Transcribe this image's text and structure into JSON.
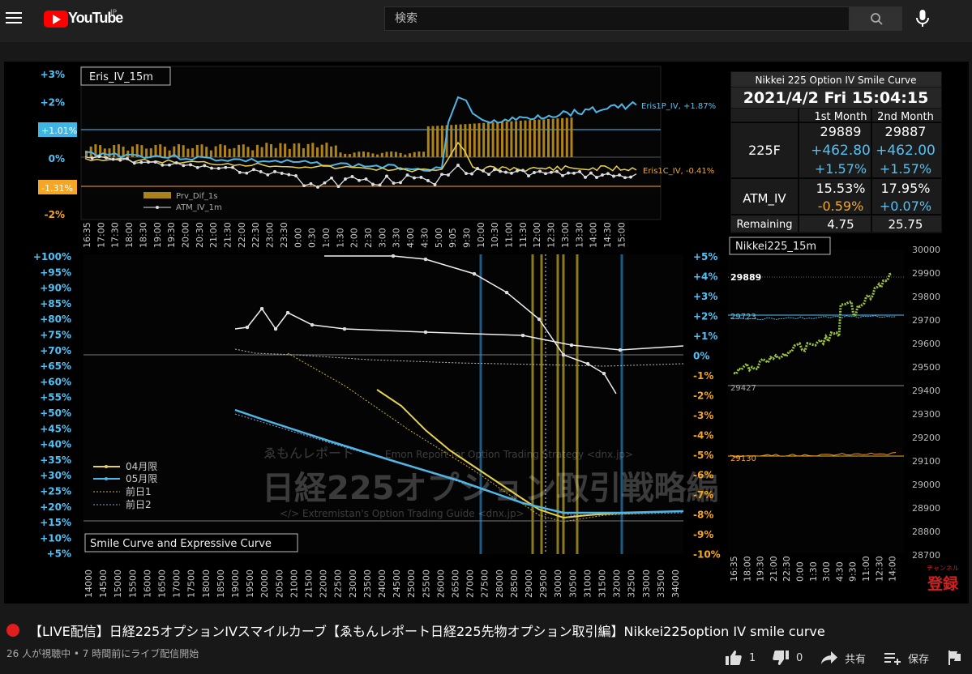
{
  "header": {
    "brand": "YouTube",
    "region": "JP",
    "search_placeholder": "検索"
  },
  "chart_top_left": {
    "label": "Eris_IV_15m",
    "y_ticks": [
      "+3%",
      "+2%",
      "+1%",
      "0%",
      "-1%",
      "-2%"
    ],
    "badge_blue": "+1.01%",
    "badge_orange": "-1.31%",
    "series_label_1": "Eris1P_IV, +1.87%",
    "series_label_2": "Eris1C_IV, -0.41%",
    "legend_1": "Prv_Dif_1s",
    "legend_2": "ATM_IV_1m",
    "x_ticks": [
      "16:35",
      "17:00",
      "17:30",
      "18:00",
      "18:30",
      "19:00",
      "19:30",
      "20:00",
      "20:30",
      "21:00",
      "21:30",
      "22:00",
      "22:30",
      "23:00",
      "23:30",
      "0:00",
      "0:30",
      "1:00",
      "1:30",
      "2:00",
      "2:30",
      "3:00",
      "3:30",
      "4:00",
      "4:30",
      "5:00",
      "9:05",
      "9:30",
      "10:00",
      "10:30",
      "11:00",
      "11:30",
      "12:00",
      "12:30",
      "13:00",
      "13:30",
      "14:00",
      "14:30",
      "15:00"
    ]
  },
  "info_table": {
    "title": "Nikkei 225 Option IV Smile Curve",
    "datetime": "2021/4/2 Fri 15:04:15",
    "col1": "1st Month",
    "col2": "2nd Month",
    "row_225f": "225F",
    "f_price_1": "29889",
    "f_price_2": "29887",
    "f_chg_1": "+462.80",
    "f_chg_2": "+462.00",
    "f_pct_1": "+1.57%",
    "f_pct_2": "+1.57%",
    "row_atm": "ATM_IV",
    "atm_1": "15.53%",
    "atm_2": "17.95%",
    "atm_chg_1": "-0.59%",
    "atm_chg_2": "+0.07%",
    "row_remaining": "Remaining",
    "rem_1": "4.75",
    "rem_2": "25.75"
  },
  "chart_smile": {
    "label": "Smile Curve and Expressive Curve",
    "y_left_ticks": [
      "+100%",
      "+95%",
      "+90%",
      "+85%",
      "+80%",
      "+75%",
      "+70%",
      "+65%",
      "+60%",
      "+55%",
      "+50%",
      "+45%",
      "+40%",
      "+35%",
      "+30%",
      "+25%",
      "+20%",
      "+15%",
      "+10%",
      "+5%"
    ],
    "y_right_ticks": [
      "+5%",
      "+4%",
      "+3%",
      "+2%",
      "+1%",
      "0%",
      "-1%",
      "-2%",
      "-3%",
      "-4%",
      "-5%",
      "-6%",
      "-7%",
      "-8%",
      "-9%",
      "-10%"
    ],
    "x_ticks": [
      "14000",
      "14500",
      "15000",
      "15500",
      "16000",
      "16500",
      "17000",
      "17500",
      "18000",
      "18500",
      "19000",
      "19500",
      "20000",
      "20500",
      "21000",
      "21500",
      "22000",
      "22500",
      "23000",
      "23500",
      "24000",
      "24500",
      "25000",
      "25500",
      "26000",
      "26500",
      "27000",
      "27500",
      "28000",
      "28500",
      "29000",
      "29500",
      "30000",
      "30500",
      "31000",
      "31500",
      "32000",
      "32500",
      "33000",
      "33500",
      "34000"
    ],
    "legend": [
      "04月限",
      "05月限",
      "前日1",
      "前日2"
    ],
    "watermark_1": "ゑもんレポート",
    "watermark_2": "Emon Report for Option Trading Strategy <dnx.jp>",
    "watermark_3": "日経225オプション取引戦略編",
    "watermark_4": "</> Extremistan's Option Trading Guide <dnx.jp>"
  },
  "chart_nikkei": {
    "label": "Nikkei225_15m",
    "y_ticks": [
      "30000",
      "29900",
      "29800",
      "29700",
      "29600",
      "29500",
      "29400",
      "29300",
      "29200",
      "29100",
      "29000",
      "28900",
      "28800",
      "28700"
    ],
    "lvl_1": "29889",
    "lvl_2": "29723",
    "lvl_3": "29427",
    "lvl_4": "29130",
    "x_ticks": [
      "16:35",
      "18:00",
      "19:30",
      "21:00",
      "22:30",
      "0:00",
      "1:30",
      "3:00",
      "4:30",
      "9:30",
      "11:00",
      "12:30",
      "14:00"
    ],
    "channel_small": "チャンネル",
    "channel_big": "登録"
  },
  "video": {
    "title": "【LIVE配信】日経225オプションIVスマイルカーブ【ゑもんレポート日経225先物オプション取引編】Nikkei225option IV smile curve",
    "meta": "26 人が視聴中 • 7 時間前にライブ配信開始",
    "likes": "1",
    "dislikes": "0",
    "share": "共有",
    "save": "保存"
  },
  "colors": {
    "accent_cyan": "#4fc3f7",
    "accent_orange": "#f5a623",
    "youtube_red": "#ff0000"
  }
}
